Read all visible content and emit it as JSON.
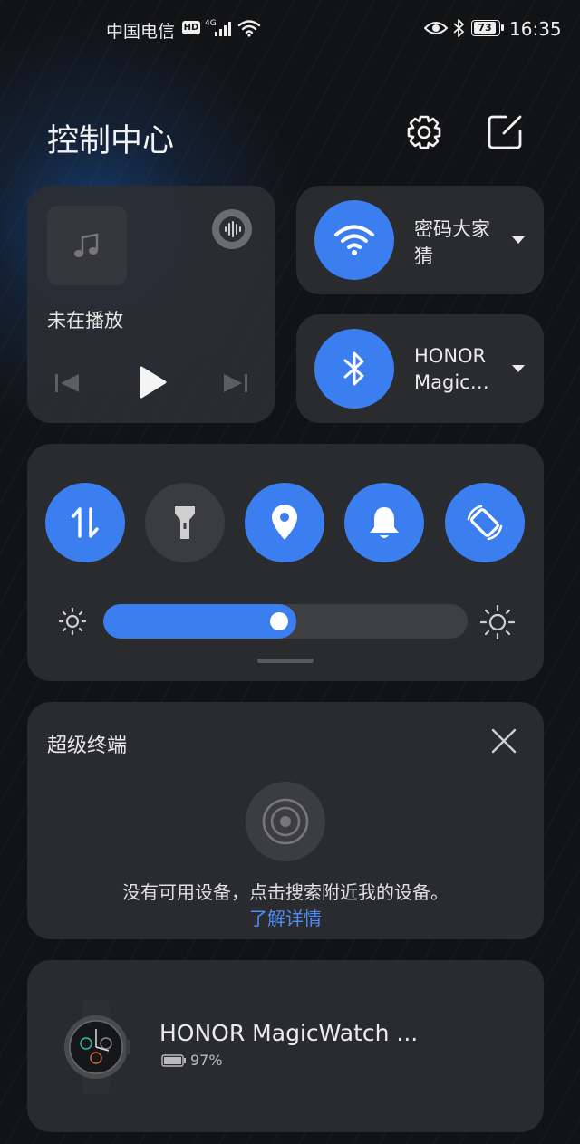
{
  "status_bar": {
    "carrier": "中国电信",
    "hd_badge": "HD",
    "network_type": "4G",
    "battery_level": "73",
    "time": "16:35"
  },
  "header": {
    "title": "控制中心",
    "settings_icon": "gear-icon",
    "edit_icon": "edit-icon"
  },
  "media_card": {
    "status": "未在播放",
    "icons": [
      "music-note-icon",
      "audio-wave-icon",
      "previous-track-icon",
      "play-icon",
      "next-track-icon"
    ]
  },
  "wifi_tile": {
    "label": "密码大家猜",
    "label_line1": "密码大家",
    "label_line2": "猜",
    "active": true,
    "accent": "#3b7ef0"
  },
  "bluetooth_tile": {
    "label_line1": "HONOR",
    "label_line2": "Magic…",
    "active": true
  },
  "toggles": [
    {
      "name": "mobile-data",
      "icon": "data-transfer-icon",
      "active": true
    },
    {
      "name": "flashlight",
      "icon": "flashlight-icon",
      "active": false
    },
    {
      "name": "location",
      "icon": "location-pin-icon",
      "active": true
    },
    {
      "name": "sound",
      "icon": "bell-icon",
      "active": true
    },
    {
      "name": "auto-rotate",
      "icon": "rotate-icon",
      "active": true
    }
  ],
  "brightness": {
    "level": 0.5
  },
  "super_device": {
    "title": "超级终端",
    "message": "没有可用设备，点击搜索附近我的设备。",
    "learn_more": "了解详情"
  },
  "device_card": {
    "name": "HONOR MagicWatch ...",
    "battery": "97%"
  },
  "colors": {
    "background": "#121315",
    "card": "#2a2b2e",
    "accent_blue": "#3b7ef0",
    "link_blue": "#4f8cf5"
  }
}
